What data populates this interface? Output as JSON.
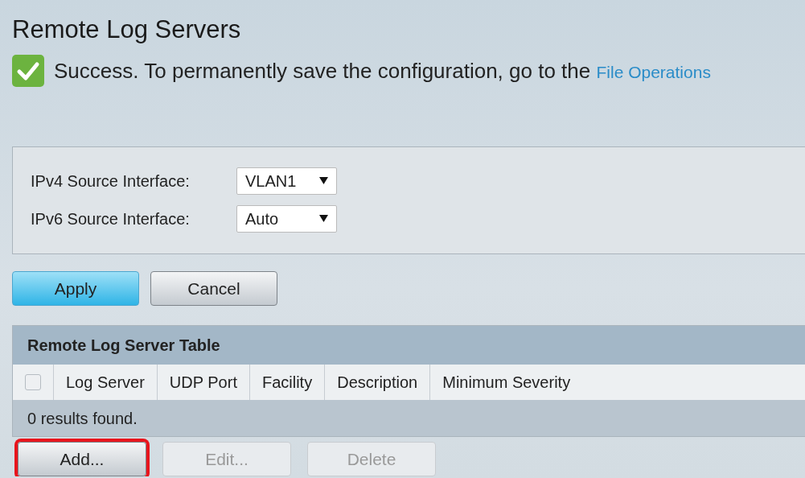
{
  "page_title": "Remote Log Servers",
  "message": {
    "kind": "success",
    "text": "Success. To permanently save the configuration, go to the ",
    "link": "File Operations"
  },
  "settings": [
    {
      "label": "IPv4 Source Interface:",
      "value": "VLAN1"
    },
    {
      "label": "IPv6 Source Interface:",
      "value": "Auto"
    }
  ],
  "form_buttons": [
    {
      "label": "Apply",
      "kind": "primary"
    },
    {
      "label": "Cancel",
      "kind": "default"
    }
  ],
  "table": {
    "title": "Remote Log Server Table",
    "select_all_checked": false,
    "columns": [
      "Log Server",
      "UDP Port",
      "Facility",
      "Description",
      "Minimum Severity"
    ],
    "status": "0 results found."
  },
  "actions": [
    {
      "label": "Add...",
      "disabled": false,
      "highlighted": true
    },
    {
      "label": "Edit...",
      "disabled": true,
      "highlighted": false
    },
    {
      "label": "Delete",
      "disabled": true,
      "highlighted": false
    }
  ]
}
